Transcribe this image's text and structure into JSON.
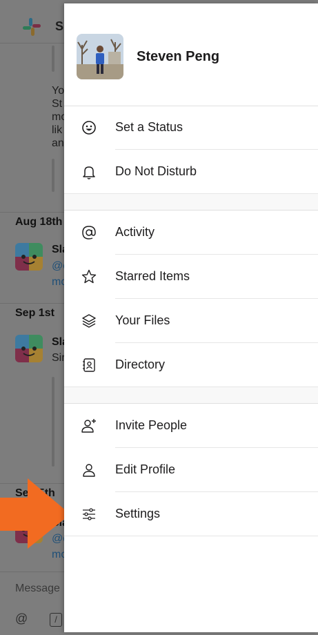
{
  "background": {
    "app_name_visible": "Sl",
    "message_fragment": [
      "Yo",
      "St",
      "mo",
      "lik",
      "an"
    ],
    "dates": [
      "Aug 18th",
      "Sep 1st",
      "Sep 5th"
    ],
    "messages": [
      {
        "sender": "Sla",
        "line1": "@c",
        "line2": "mo"
      },
      {
        "sender": "Sla",
        "line1": "Sir"
      },
      {
        "sender": "Sla",
        "line1": "@c",
        "line2": "mo"
      }
    ],
    "composer_placeholder": "Message"
  },
  "drawer": {
    "user_name": "Steven Peng",
    "menu_groups": [
      [
        {
          "label": "Set a Status",
          "icon": "smiley-icon"
        },
        {
          "label": "Do Not Disturb",
          "icon": "bell-icon"
        }
      ],
      [
        {
          "label": "Activity",
          "icon": "at-sign-icon"
        },
        {
          "label": "Starred Items",
          "icon": "star-icon"
        },
        {
          "label": "Your Files",
          "icon": "layers-icon"
        },
        {
          "label": "Directory",
          "icon": "address-book-icon"
        }
      ],
      [
        {
          "label": "Invite People",
          "icon": "add-person-icon"
        },
        {
          "label": "Edit Profile",
          "icon": "person-icon"
        },
        {
          "label": "Settings",
          "icon": "sliders-icon"
        }
      ]
    ]
  },
  "colors": {
    "overlay": "#7d7d7d",
    "drawer_bg": "#ffffff",
    "arrow": "#f26b21",
    "text": "#1d1c1d"
  }
}
